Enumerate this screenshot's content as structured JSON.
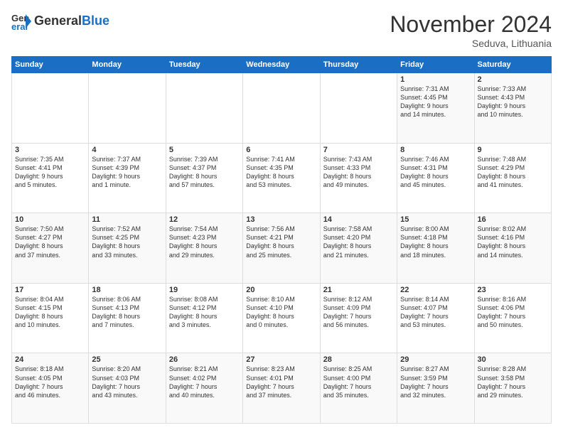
{
  "logo": {
    "line1": "General",
    "line2": "Blue"
  },
  "header": {
    "month": "November 2024",
    "location": "Seduva, Lithuania"
  },
  "weekdays": [
    "Sunday",
    "Monday",
    "Tuesday",
    "Wednesday",
    "Thursday",
    "Friday",
    "Saturday"
  ],
  "weeks": [
    [
      {
        "day": "",
        "info": ""
      },
      {
        "day": "",
        "info": ""
      },
      {
        "day": "",
        "info": ""
      },
      {
        "day": "",
        "info": ""
      },
      {
        "day": "",
        "info": ""
      },
      {
        "day": "1",
        "info": "Sunrise: 7:31 AM\nSunset: 4:45 PM\nDaylight: 9 hours\nand 14 minutes."
      },
      {
        "day": "2",
        "info": "Sunrise: 7:33 AM\nSunset: 4:43 PM\nDaylight: 9 hours\nand 10 minutes."
      }
    ],
    [
      {
        "day": "3",
        "info": "Sunrise: 7:35 AM\nSunset: 4:41 PM\nDaylight: 9 hours\nand 5 minutes."
      },
      {
        "day": "4",
        "info": "Sunrise: 7:37 AM\nSunset: 4:39 PM\nDaylight: 9 hours\nand 1 minute."
      },
      {
        "day": "5",
        "info": "Sunrise: 7:39 AM\nSunset: 4:37 PM\nDaylight: 8 hours\nand 57 minutes."
      },
      {
        "day": "6",
        "info": "Sunrise: 7:41 AM\nSunset: 4:35 PM\nDaylight: 8 hours\nand 53 minutes."
      },
      {
        "day": "7",
        "info": "Sunrise: 7:43 AM\nSunset: 4:33 PM\nDaylight: 8 hours\nand 49 minutes."
      },
      {
        "day": "8",
        "info": "Sunrise: 7:46 AM\nSunset: 4:31 PM\nDaylight: 8 hours\nand 45 minutes."
      },
      {
        "day": "9",
        "info": "Sunrise: 7:48 AM\nSunset: 4:29 PM\nDaylight: 8 hours\nand 41 minutes."
      }
    ],
    [
      {
        "day": "10",
        "info": "Sunrise: 7:50 AM\nSunset: 4:27 PM\nDaylight: 8 hours\nand 37 minutes."
      },
      {
        "day": "11",
        "info": "Sunrise: 7:52 AM\nSunset: 4:25 PM\nDaylight: 8 hours\nand 33 minutes."
      },
      {
        "day": "12",
        "info": "Sunrise: 7:54 AM\nSunset: 4:23 PM\nDaylight: 8 hours\nand 29 minutes."
      },
      {
        "day": "13",
        "info": "Sunrise: 7:56 AM\nSunset: 4:21 PM\nDaylight: 8 hours\nand 25 minutes."
      },
      {
        "day": "14",
        "info": "Sunrise: 7:58 AM\nSunset: 4:20 PM\nDaylight: 8 hours\nand 21 minutes."
      },
      {
        "day": "15",
        "info": "Sunrise: 8:00 AM\nSunset: 4:18 PM\nDaylight: 8 hours\nand 18 minutes."
      },
      {
        "day": "16",
        "info": "Sunrise: 8:02 AM\nSunset: 4:16 PM\nDaylight: 8 hours\nand 14 minutes."
      }
    ],
    [
      {
        "day": "17",
        "info": "Sunrise: 8:04 AM\nSunset: 4:15 PM\nDaylight: 8 hours\nand 10 minutes."
      },
      {
        "day": "18",
        "info": "Sunrise: 8:06 AM\nSunset: 4:13 PM\nDaylight: 8 hours\nand 7 minutes."
      },
      {
        "day": "19",
        "info": "Sunrise: 8:08 AM\nSunset: 4:12 PM\nDaylight: 8 hours\nand 3 minutes."
      },
      {
        "day": "20",
        "info": "Sunrise: 8:10 AM\nSunset: 4:10 PM\nDaylight: 8 hours\nand 0 minutes."
      },
      {
        "day": "21",
        "info": "Sunrise: 8:12 AM\nSunset: 4:09 PM\nDaylight: 7 hours\nand 56 minutes."
      },
      {
        "day": "22",
        "info": "Sunrise: 8:14 AM\nSunset: 4:07 PM\nDaylight: 7 hours\nand 53 minutes."
      },
      {
        "day": "23",
        "info": "Sunrise: 8:16 AM\nSunset: 4:06 PM\nDaylight: 7 hours\nand 50 minutes."
      }
    ],
    [
      {
        "day": "24",
        "info": "Sunrise: 8:18 AM\nSunset: 4:05 PM\nDaylight: 7 hours\nand 46 minutes."
      },
      {
        "day": "25",
        "info": "Sunrise: 8:20 AM\nSunset: 4:03 PM\nDaylight: 7 hours\nand 43 minutes."
      },
      {
        "day": "26",
        "info": "Sunrise: 8:21 AM\nSunset: 4:02 PM\nDaylight: 7 hours\nand 40 minutes."
      },
      {
        "day": "27",
        "info": "Sunrise: 8:23 AM\nSunset: 4:01 PM\nDaylight: 7 hours\nand 37 minutes."
      },
      {
        "day": "28",
        "info": "Sunrise: 8:25 AM\nSunset: 4:00 PM\nDaylight: 7 hours\nand 35 minutes."
      },
      {
        "day": "29",
        "info": "Sunrise: 8:27 AM\nSunset: 3:59 PM\nDaylight: 7 hours\nand 32 minutes."
      },
      {
        "day": "30",
        "info": "Sunrise: 8:28 AM\nSunset: 3:58 PM\nDaylight: 7 hours\nand 29 minutes."
      }
    ]
  ]
}
